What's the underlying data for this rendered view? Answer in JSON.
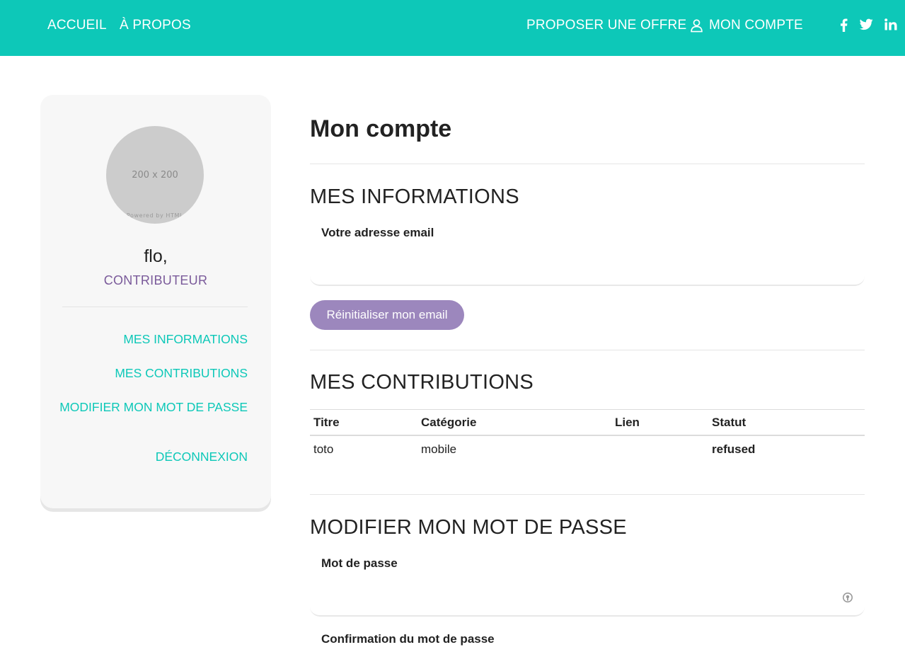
{
  "nav": {
    "accueil": "ACCUEIL",
    "apropos": "À PROPOS",
    "proposer": "PROPOSER UNE OFFRE",
    "compte": "MON COMPTE",
    "social_icons": [
      "facebook-icon",
      "twitter-icon",
      "linkedin-icon"
    ],
    "bg_color": "#0dc8b8"
  },
  "sidebar": {
    "avatar_placeholder": "200 x 200",
    "avatar_powered": "Powered by HTML",
    "user_name": "flo,",
    "user_role": "CONTRIBUTEUR",
    "links": [
      "MES INFORMATIONS",
      "MES CONTRIBUTIONS",
      "MODIFIER MON MOT DE PASSE",
      "DÉCONNEXION"
    ],
    "link_color": "#0dc8b8",
    "role_color": "#7a5a9a"
  },
  "main": {
    "title": "Mon compte",
    "infos": {
      "heading": "MES INFORMATIONS",
      "email_label": "Votre adresse email",
      "email_value": "",
      "reset_button": "Réinitialiser mon email",
      "button_color": "#9c87bd"
    },
    "contributions": {
      "heading": "MES CONTRIBUTIONS",
      "columns": [
        "Titre",
        "Catégorie",
        "Lien",
        "Statut"
      ],
      "rows": [
        {
          "titre": "toto",
          "categorie": "mobile",
          "lien": "",
          "statut": "refused"
        }
      ]
    },
    "password": {
      "heading": "MODIFIER MON MOT DE PASSE",
      "password_label": "Mot de passe",
      "password_value": "",
      "confirm_label": "Confirmation du mot de passe"
    }
  }
}
